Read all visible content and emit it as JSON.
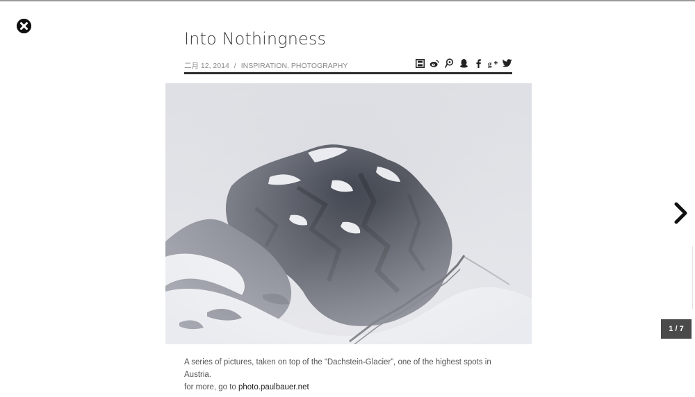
{
  "window": {
    "close_icon": "close-icon",
    "next_icon": "chevron-right-icon"
  },
  "post": {
    "title": "Into Nothingness",
    "date": "二月 12, 2014",
    "separator": "/",
    "categories": [
      "INSPIRATION",
      "PHOTOGRAPHY"
    ],
    "category_joiner": ", "
  },
  "share": {
    "icons": [
      {
        "name": "save-icon",
        "glyph": "▣"
      },
      {
        "name": "weibo-icon",
        "glyph": "◎"
      },
      {
        "name": "tencent-weibo-icon",
        "glyph": "ⓟ"
      },
      {
        "name": "qq-icon",
        "glyph": "♟"
      },
      {
        "name": "facebook-icon",
        "glyph": "f"
      },
      {
        "name": "google-plus-icon",
        "glyph": "g+"
      },
      {
        "name": "twitter-icon",
        "glyph": "🐦"
      }
    ]
  },
  "photo": {
    "subject": "snow-covered-rock-peak-in-fog"
  },
  "caption": {
    "line1": "A series of pictures, taken on top of the “Dachstein-Glacier”, one of the highest spots in Austria.",
    "line2_prefix": "for more, go to ",
    "line2_link": "photo.paulbauer.net"
  },
  "pager": {
    "counter": "1 / 7"
  },
  "colors": {
    "counter_bg": "#4a4a4a",
    "rule": "#2b2b2b",
    "meta_text": "#888888"
  }
}
